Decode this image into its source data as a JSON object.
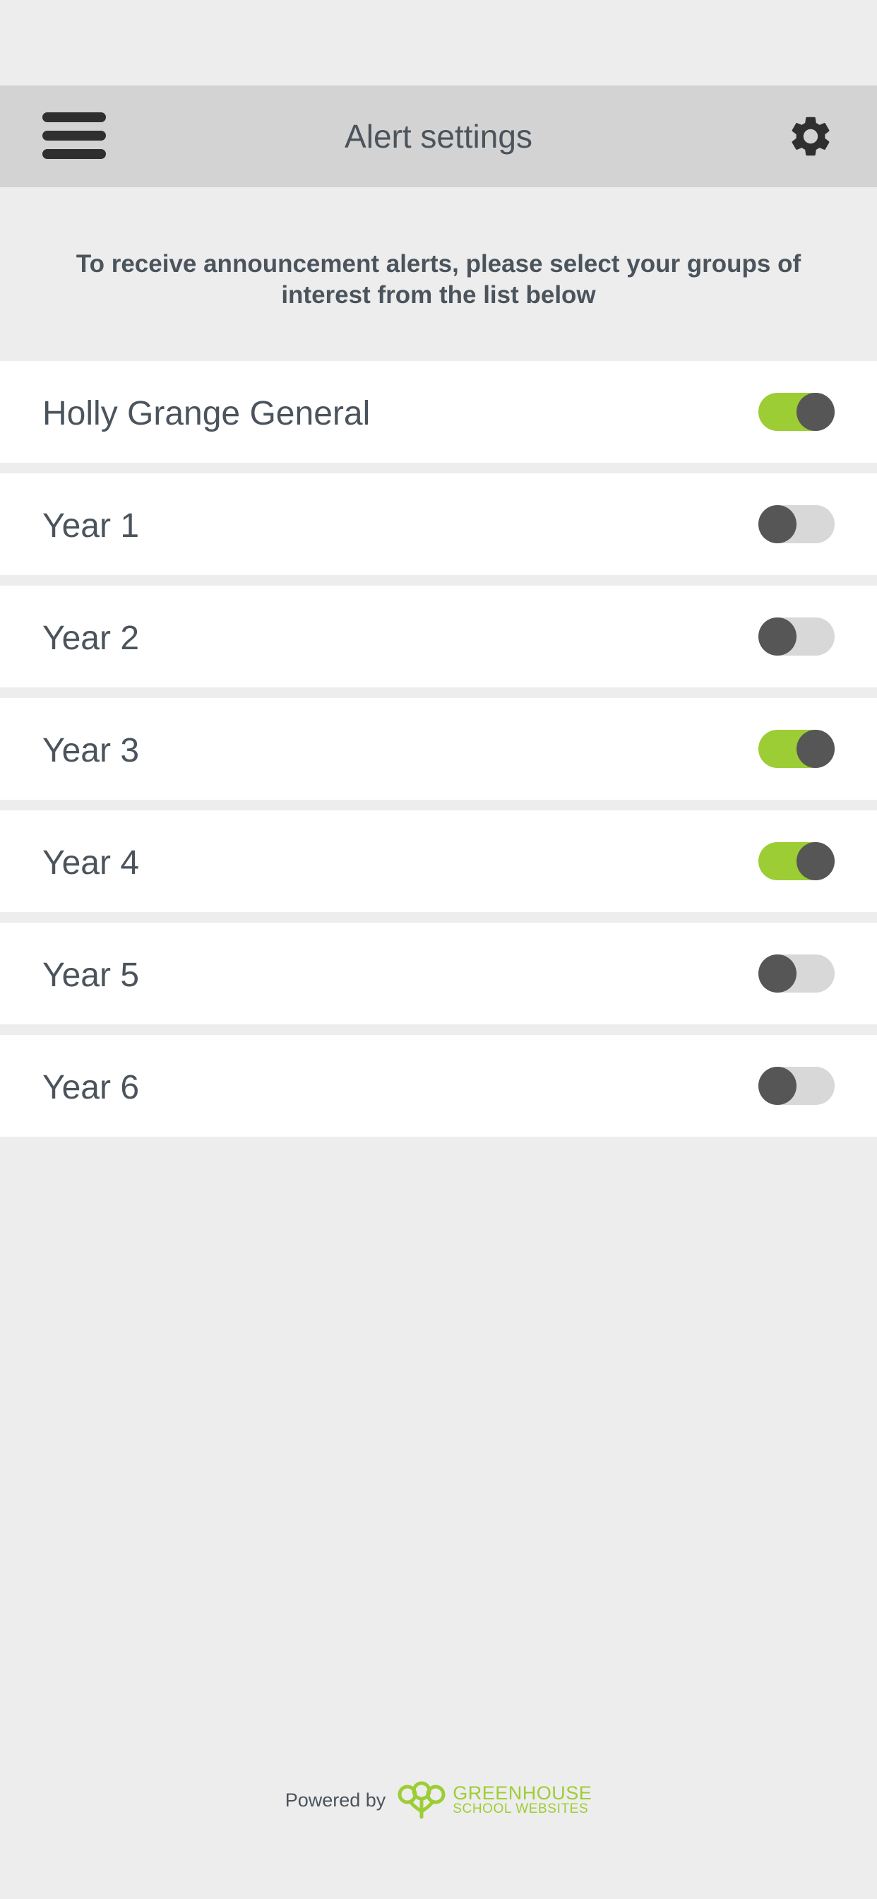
{
  "header": {
    "title": "Alert settings",
    "menu_icon": "hamburger-menu-icon",
    "settings_icon": "gear-icon"
  },
  "intro_text": "To receive announcement alerts, please select your groups of interest from the list below",
  "groups": [
    {
      "label": "Holly Grange General",
      "enabled": true
    },
    {
      "label": "Year 1",
      "enabled": false
    },
    {
      "label": "Year 2",
      "enabled": false
    },
    {
      "label": "Year 3",
      "enabled": true
    },
    {
      "label": "Year 4",
      "enabled": true
    },
    {
      "label": "Year 5",
      "enabled": false
    },
    {
      "label": "Year 6",
      "enabled": false
    }
  ],
  "footer": {
    "powered_by": "Powered by",
    "brand_line1": "GREENHOUSE",
    "brand_line2": "SCHOOL WEBSITES"
  },
  "colors": {
    "header_bg": "#d3d3d3",
    "page_bg": "#ededed",
    "accent_green": "#9dcd35",
    "knob": "#565656",
    "text": "#4b545c"
  }
}
